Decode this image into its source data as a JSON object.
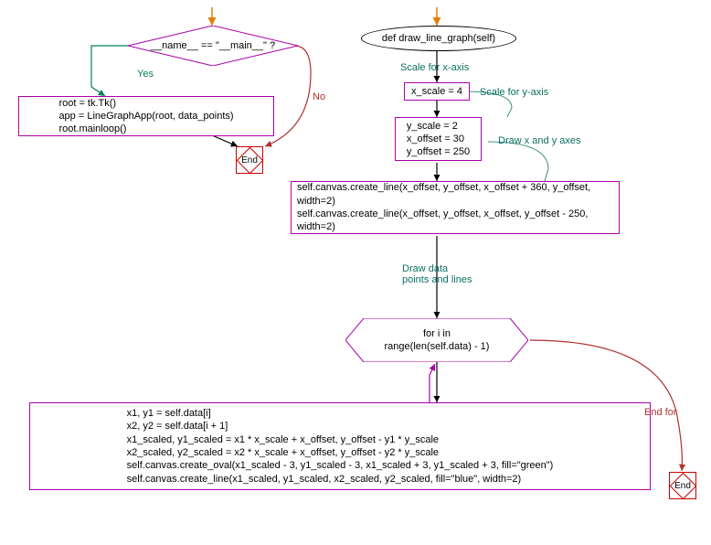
{
  "left": {
    "decision": "__name__ == \"__main__\" ?",
    "yes_label": "Yes",
    "no_label": "No",
    "code": "root = tk.Tk()\napp = LineGraphApp(root, data_points)\nroot.mainloop()",
    "end_label": "End"
  },
  "right": {
    "func_def": "def draw_line_graph(self)",
    "label_scale_x": "Scale for x-axis",
    "box_xscale": "x_scale = 4",
    "label_scale_y": "Scale for y-axis",
    "box_offsets": "y_scale = 2\nx_offset = 30\ny_offset = 250",
    "label_draw_axes": "Draw x and y axes",
    "box_axes": "self.canvas.create_line(x_offset, y_offset, x_offset + 360, y_offset, width=2)\nself.canvas.create_line(x_offset, y_offset, x_offset, y_offset - 250, width=2)",
    "label_draw_points": "Draw data\npoints and lines",
    "loop": "for i in\nrange(len(self.data) - 1)",
    "box_loopbody": "x1, y1 = self.data[i]\nx2, y2 = self.data[i + 1]\nx1_scaled, y1_scaled = x1 * x_scale + x_offset, y_offset - y1 * y_scale\nx2_scaled, y2_scaled = x2 * x_scale + x_offset, y_offset - y2 * y_scale\nself.canvas.create_oval(x1_scaled - 3, y1_scaled - 3, x1_scaled + 3, y1_scaled + 3, fill=\"green\")\nself.canvas.create_line(x1_scaled, y1_scaled, x2_scaled, y2_scaled, fill=\"blue\", width=2)",
    "endfor_label": "End for",
    "end_label": "End"
  }
}
